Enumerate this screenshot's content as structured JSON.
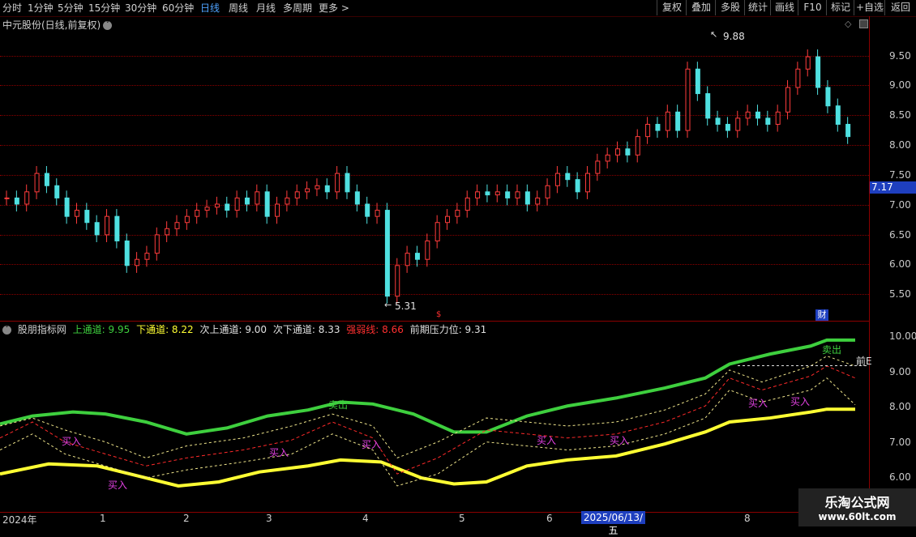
{
  "toolbar": {
    "periods": [
      {
        "label": "分时",
        "active": false
      },
      {
        "label": "1分钟",
        "active": false
      },
      {
        "label": "5分钟",
        "active": false
      },
      {
        "label": "15分钟",
        "active": false
      },
      {
        "label": "30分钟",
        "active": false
      },
      {
        "label": "60分钟",
        "active": false
      },
      {
        "label": "日线",
        "active": true
      },
      {
        "label": "周线",
        "active": false
      },
      {
        "label": "月线",
        "active": false
      },
      {
        "label": "多周期",
        "active": false
      },
      {
        "label": "更多 >",
        "active": false
      }
    ],
    "actions": [
      "复权",
      "叠加",
      "多股",
      "统计",
      "画线",
      "F10",
      "标记",
      "+自选",
      "返回"
    ]
  },
  "main_chart": {
    "title": "中元股份(日线,前复权)",
    "price_axis": [
      "9.50",
      "9.00",
      "8.50",
      "8.00",
      "7.50",
      "7.00",
      "6.50",
      "6.00",
      "5.50"
    ],
    "current_price": "7.17",
    "high_label": "9.88",
    "low_label": "5.31",
    "marker_fin": "财"
  },
  "indicator": {
    "name": "股朋指标网",
    "items": [
      {
        "label": "上通道: 9.95",
        "color": "#3ecf3e"
      },
      {
        "label": "下通道: 8.22",
        "color": "#ffff33"
      },
      {
        "label": "次上通道: 9.00",
        "color": "#e0e0e0"
      },
      {
        "label": "次下通道: 8.33",
        "color": "#e0e0e0"
      },
      {
        "label": "强弱线: 8.66",
        "color": "#ff3030"
      },
      {
        "label": "前期压力位: 9.31",
        "color": "#e0e0e0"
      }
    ],
    "axis": [
      "10.00",
      "9.00",
      "8.00",
      "7.00",
      "6.00"
    ],
    "signals": {
      "buy": "买入",
      "sell": "卖出",
      "pressure": "前E"
    }
  },
  "xaxis": {
    "labels": [
      "2024年",
      "1",
      "2",
      "3",
      "4",
      "5",
      "6",
      "8"
    ],
    "cursor_date": "2025/06/13/五"
  },
  "watermark": {
    "line1": "乐淘公式网",
    "line2": "www.60lt.com"
  },
  "chart_data": {
    "type": "candlestick",
    "title": "中元股份(日线,前复权)",
    "ylim": [
      5.2,
      9.95
    ],
    "high": 9.88,
    "low": 5.31,
    "last": 7.17,
    "close_series": [
      7.2,
      7.1,
      7.3,
      7.6,
      7.4,
      7.2,
      6.9,
      7.0,
      6.8,
      6.6,
      6.9,
      6.5,
      6.1,
      6.2,
      6.3,
      6.6,
      6.7,
      6.8,
      6.9,
      7.0,
      7.05,
      7.1,
      7.0,
      7.2,
      7.1,
      7.3,
      6.9,
      7.1,
      7.2,
      7.3,
      7.35,
      7.4,
      7.3,
      7.6,
      7.3,
      7.1,
      6.9,
      7.0,
      5.6,
      6.1,
      6.3,
      6.2,
      6.5,
      6.8,
      6.9,
      7.0,
      7.2,
      7.3,
      7.25,
      7.3,
      7.2,
      7.3,
      7.1,
      7.2,
      7.4,
      7.6,
      7.5,
      7.3,
      7.6,
      7.8,
      7.9,
      8.0,
      7.9,
      8.2,
      8.4,
      8.3,
      8.6,
      8.3,
      9.3,
      8.9,
      8.5,
      8.4,
      8.3,
      8.5,
      8.6,
      8.5,
      8.4,
      8.6,
      9.0,
      9.3,
      9.5,
      9.0,
      8.7,
      8.4,
      8.2
    ]
  }
}
